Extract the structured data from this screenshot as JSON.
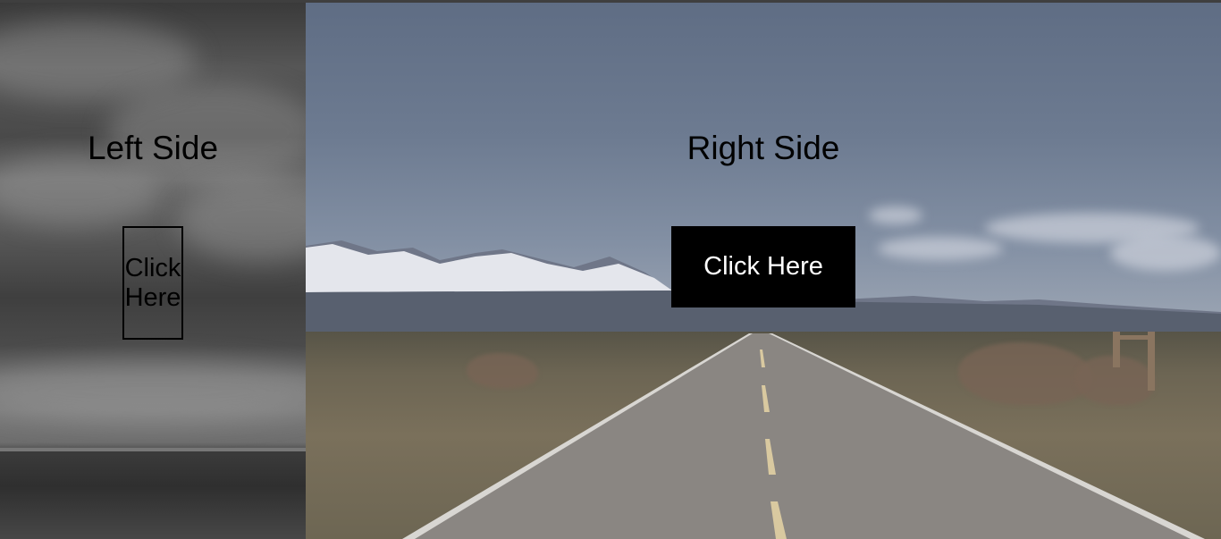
{
  "left_panel": {
    "heading": "Left Side",
    "button_label": "Click Here"
  },
  "right_panel": {
    "heading": "Right Side",
    "button_label": "Click Here"
  },
  "colors": {
    "heading_text": "#000000",
    "left_button_border": "#000000",
    "right_button_bg": "#000000",
    "right_button_text": "#ffffff"
  }
}
